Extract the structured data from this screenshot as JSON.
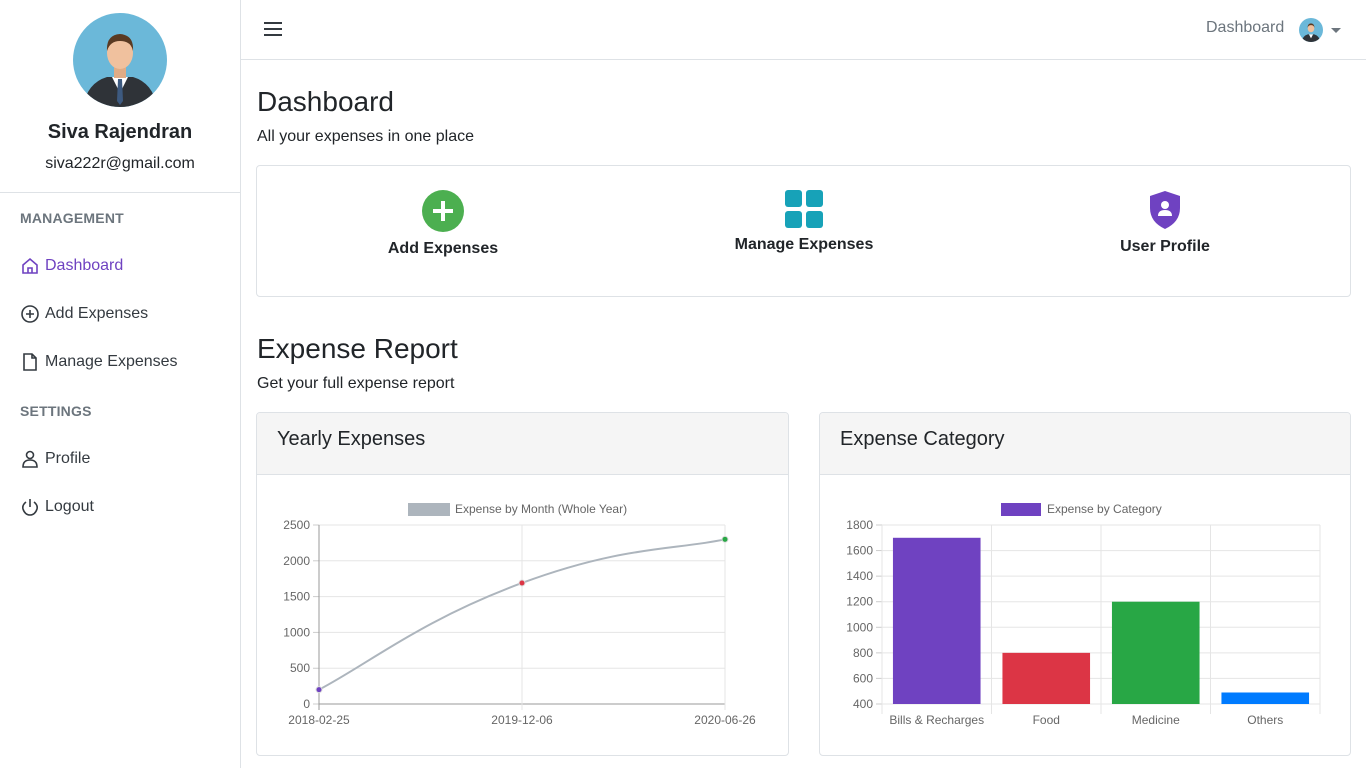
{
  "user": {
    "name": "Siva Rajendran",
    "email": "siva222r@gmail.com"
  },
  "sidebar": {
    "management_heading": "MANAGEMENT",
    "settings_heading": "SETTINGS",
    "items": [
      {
        "label": "Dashboard",
        "icon": "home-icon"
      },
      {
        "label": "Add Expenses",
        "icon": "plus-circle-icon"
      },
      {
        "label": "Manage Expenses",
        "icon": "file-icon"
      },
      {
        "label": "Profile",
        "icon": "person-icon"
      },
      {
        "label": "Logout",
        "icon": "power-icon"
      }
    ]
  },
  "topbar": {
    "link": "Dashboard"
  },
  "page": {
    "title": "Dashboard",
    "subtitle": "All your expenses in one place"
  },
  "actions": [
    {
      "label": "Add Expenses",
      "icon": "plus-circle-icon",
      "color": "#4caf50"
    },
    {
      "label": "Manage Expenses",
      "icon": "grid-icon",
      "color": "#17a2b8"
    },
    {
      "label": "User Profile",
      "icon": "shield-user-icon",
      "color": "#6f42c1"
    }
  ],
  "report": {
    "title": "Expense Report",
    "subtitle": "Get your full expense report"
  },
  "colors": {
    "accent": "#6f42c1",
    "line": "#adb5bd"
  },
  "chart_data": [
    {
      "type": "line",
      "card_title": "Yearly Expenses",
      "legend": "Expense by Month (Whole Year)",
      "x": [
        "2018-02-25",
        "2019-12-06",
        "2020-06-26"
      ],
      "values": [
        200,
        1690,
        2300
      ],
      "point_colors": [
        "#6f42c1",
        "#dc3545",
        "#28a745"
      ],
      "ylim": [
        0,
        2500
      ],
      "yticks": [
        0,
        500,
        1000,
        1500,
        2000,
        2500
      ],
      "grid": true
    },
    {
      "type": "bar",
      "card_title": "Expense Category",
      "legend": "Expense by Category",
      "categories": [
        "Bills & Recharges",
        "Food",
        "Medicine",
        "Others"
      ],
      "values": [
        1700,
        800,
        1200,
        490
      ],
      "bar_colors": [
        "#6f42c1",
        "#dc3545",
        "#28a745",
        "#007bff"
      ],
      "ylim": [
        400,
        1800
      ],
      "yticks": [
        400,
        600,
        800,
        1000,
        1200,
        1400,
        1600,
        1800
      ],
      "grid": true
    }
  ]
}
